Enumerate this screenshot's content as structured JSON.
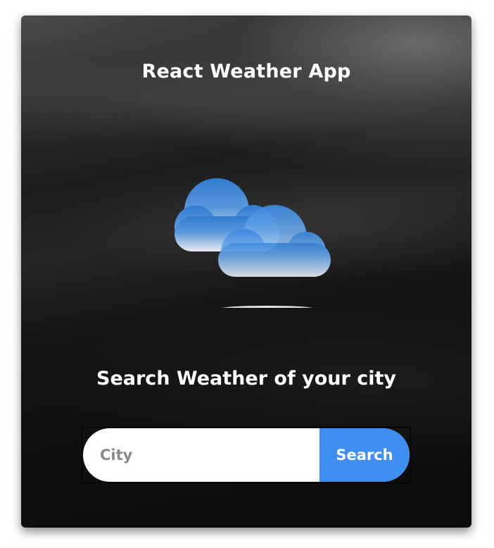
{
  "app": {
    "title": "React Weather App"
  },
  "hero": {
    "icon": "partly-cloudy-icon",
    "subtitle": "Search Weather of your city"
  },
  "search": {
    "placeholder": "City",
    "value": "",
    "button_label": "Search"
  },
  "colors": {
    "accent": "#3f8ff0",
    "cloud_top": "#2f7fd6",
    "cloud_bottom": "#e9eef6",
    "background": "#111111"
  }
}
